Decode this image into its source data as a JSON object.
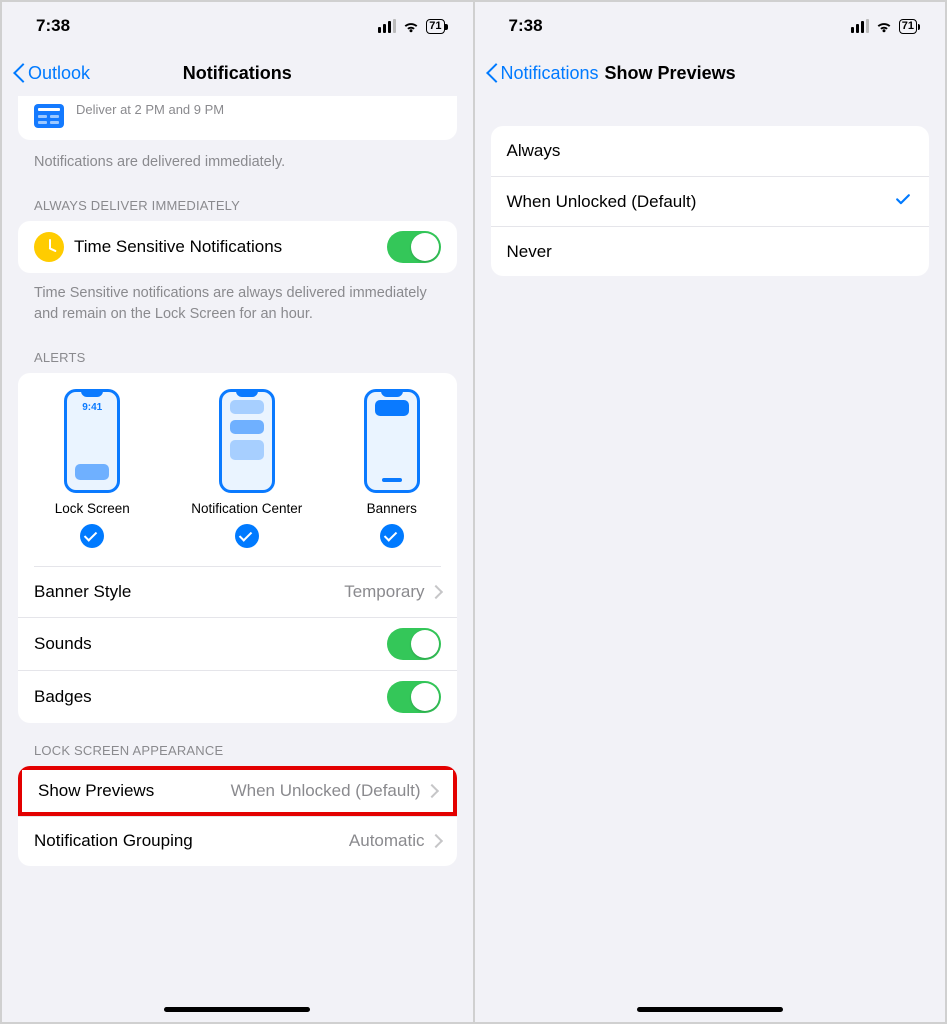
{
  "status": {
    "time": "7:38",
    "battery": "71"
  },
  "left": {
    "back_label": "Outlook",
    "title": "Notifications",
    "deliver_sub": "Deliver at 2 PM and 9 PM",
    "delivered_note": "Notifications are delivered immediately.",
    "sect_always": "ALWAYS DELIVER IMMEDIATELY",
    "ts_label": "Time Sensitive Notifications",
    "ts_note": "Time Sensitive notifications are always delivered immediately and remain on the Lock Screen for an hour.",
    "sect_alerts": "ALERTS",
    "alert_opts": {
      "lock": "Lock Screen",
      "nc": "Notification Center",
      "ban": "Banners"
    },
    "alert_time": "9:41",
    "banner_style_label": "Banner Style",
    "banner_style_value": "Temporary",
    "sounds_label": "Sounds",
    "badges_label": "Badges",
    "sect_lock": "LOCK SCREEN APPEARANCE",
    "show_previews_label": "Show Previews",
    "show_previews_value": "When Unlocked (Default)",
    "grouping_label": "Notification Grouping",
    "grouping_value": "Automatic"
  },
  "right": {
    "back_label": "Notifications",
    "title": "Show Previews",
    "options": {
      "always": "Always",
      "unlocked": "When Unlocked (Default)",
      "never": "Never"
    }
  }
}
